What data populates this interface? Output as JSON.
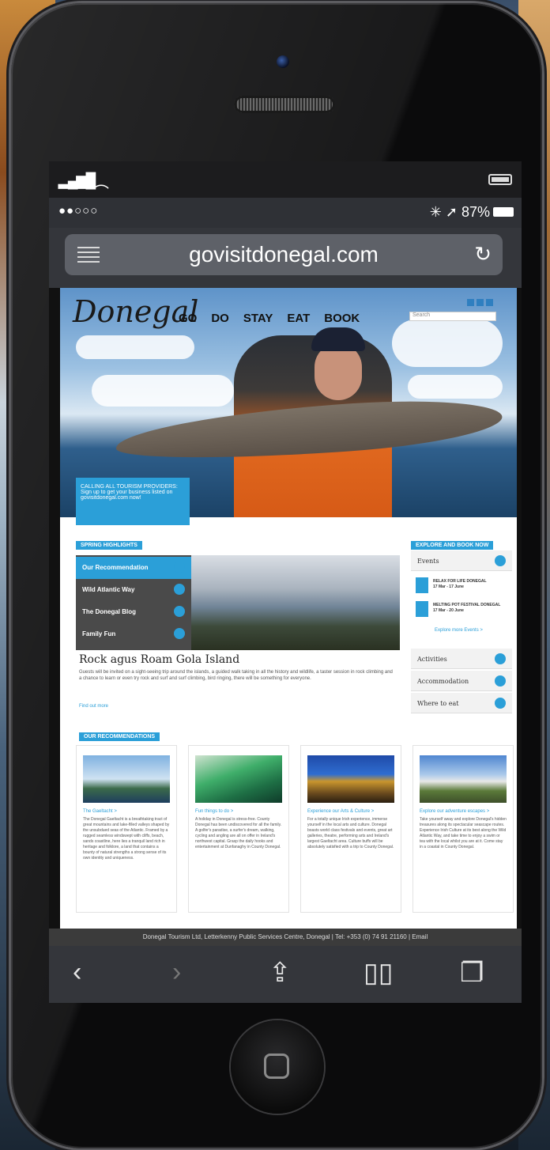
{
  "status": {
    "carrier_dots": "●●○○○",
    "battery_percent": "87%"
  },
  "browser": {
    "url": "govisitdonegal.com"
  },
  "site": {
    "logo": "Donegal",
    "nav": [
      "GO",
      "DO",
      "STAY",
      "EAT",
      "BOOK"
    ],
    "search_placeholder": "Search",
    "trade_box": "CALLING ALL TOURISM PROVIDERS: Sign up to get your business listed on govisitdonegal.com now!",
    "highlights_label": "SPRING HIGHLIGHTS",
    "highlight_menu": [
      "Our Recommendation",
      "Wild Atlantic Way",
      "The Donegal Blog",
      "Family Fun"
    ],
    "highlight_title": "Rock agus Roam Gola Island",
    "highlight_text": "Guests will be invited on a sight-seeing trip around the islands, a guided walk taking in all the history and wildlife, a taster session in rock climbing and a chance to learn or even try rock and surf and surf climbing, bird ringing, there will be something for everyone.",
    "highlight_more": "Find out more",
    "explore_label": "EXPLORE AND BOOK NOW",
    "side_items": [
      "Events",
      "Activities",
      "Accommodation",
      "Where to eat"
    ],
    "events": [
      {
        "name": "RELAX FOR LIFE DONEGAL",
        "dates": "17 Mar - 17 June"
      },
      {
        "name": "MELTING POT FESTIVAL DONEGAL",
        "dates": "17 Mar - 20 June"
      }
    ],
    "events_more": "Explore more Events >",
    "recs_label": "OUR RECOMMENDATIONS",
    "cards": [
      {
        "title": "The Gaeltacht >",
        "text": "The Donegal Gaeltacht is a breathtaking tract of great mountains and lake-filled valleys shaped by the unsubdued seas of the Atlantic. Framed by a rugged seamless windswept with cliffs, beach, sands coastline, here lies a tranquil land rich in heritage and folklore, a land that contains a bounty of natural strengths a strong sense of its own identity and uniqueness."
      },
      {
        "title": "Fun things to do >",
        "text": "A holiday in Donegal is stress-free. County Donegal has been undiscovered for all the family. A golfer's paradise, a surfer's dream, walking, cycling and angling are all on offer in Ireland's northwest capital. Grasp the daily hooks and entertainment at Dunfanaghy in County Donegal."
      },
      {
        "title": "Experience our Arts & Culture >",
        "text": "For a totally unique Irish experience, immerse yourself in the local arts and culture. Donegal boasts world class festivals and events, great art galleries, theatre, performing arts and Ireland's largest Gaeltacht area. Culture buffs will be absolutely satisfied with a trip to County Donegal."
      },
      {
        "title": "Explore our adventure escapes >",
        "text": "Take yourself away and explore Donegal's hidden treasures along its spectacular seascape routes. Experience Irish Culture at its best along the Wild Atlantic Way, and take time to enjoy a swim or tea with the local whilst you are at it. Come stay in a coastal in County Donegal."
      }
    ],
    "footer": "Donegal Tourism Ltd, Letterkenny Public Services Centre, Donegal | Tel: +353 (0) 74 91 21160 | Email"
  }
}
